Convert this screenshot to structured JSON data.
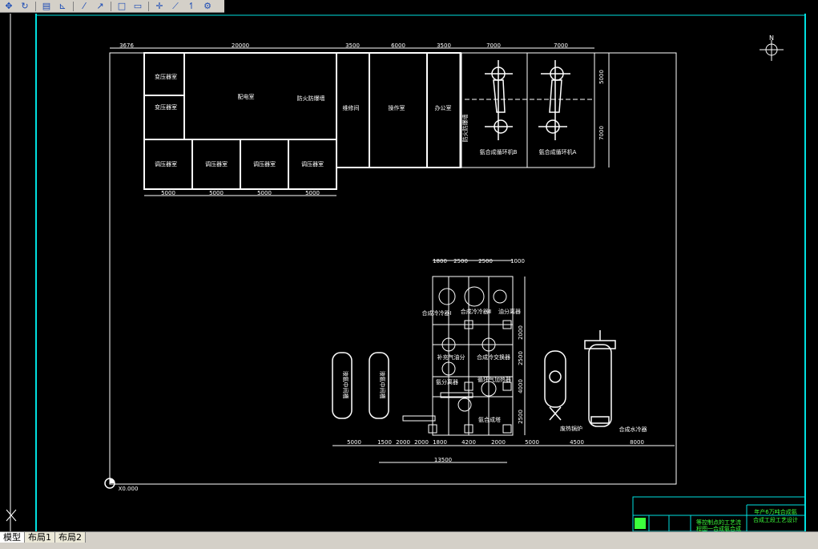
{
  "toolbar": {
    "buttons": [
      {
        "icon": "pan-icon",
        "glyph": "✥"
      },
      {
        "icon": "orbit-icon",
        "glyph": "↻"
      },
      {
        "icon": "sheet-icon",
        "glyph": "▤"
      },
      {
        "icon": "measure-icon",
        "glyph": "⊾"
      },
      {
        "icon": "line-icon",
        "glyph": "⁄"
      },
      {
        "icon": "polyline-icon",
        "glyph": "↗"
      },
      {
        "icon": "rectangle-icon",
        "glyph": "□"
      },
      {
        "icon": "box-icon",
        "glyph": "▭"
      },
      {
        "icon": "move-icon",
        "glyph": "✛"
      },
      {
        "icon": "arc-icon",
        "glyph": "⟋"
      },
      {
        "icon": "pin-icon",
        "glyph": "↿"
      },
      {
        "icon": "properties-icon",
        "glyph": "⚙"
      }
    ]
  },
  "colors": {
    "background": "#000000",
    "lines": "#ffffff",
    "border": "#00e0e0",
    "titleblock_text": "#3cff3c"
  },
  "plan_top": {
    "dims": {
      "d1": "3676",
      "d2": "20000",
      "d3": "3500",
      "d4": "6000",
      "d5": "3500",
      "d6": "7000",
      "d7": "7000",
      "b1": "5000",
      "b2": "5000",
      "b3": "5000",
      "b4": "5000",
      "r1": "5000",
      "r2": "7000"
    },
    "rooms": {
      "transformer1": "变压器室",
      "transformer2": "变压器室",
      "distribution": "配电室",
      "firewall1": "防火防爆墙",
      "repair": "维修间",
      "operation": "操作室",
      "office": "办公室",
      "firewall2": "防火防爆墙",
      "regulator1": "调压器室",
      "regulator2": "调压器室",
      "regulator3": "调压器室",
      "regulator4": "调压器室",
      "compressor_b": "氨合成循环机B",
      "compressor_a": "氨合成循环机A"
    }
  },
  "plan_bottom": {
    "top_dims": {
      "t1": "1800",
      "t2": "2500",
      "t3": "2500",
      "t4": "1000"
    },
    "side_dims": {
      "s1": "2000",
      "s2": "2500",
      "s3": "4000",
      "s4": "2500"
    },
    "bottom_dims": {
      "b1": "5000",
      "b2": "1500",
      "b3": "2000",
      "b4": "2000",
      "b5": "1800",
      "b6": "4200",
      "b7": "2000",
      "b8": "5000",
      "b9": "4500",
      "b10": "8000",
      "total": "13500"
    },
    "equipment": {
      "cooler1": "合成冷冷器Ⅰ",
      "cooler2": "合成冷冷器Ⅱ",
      "separator": "油分离器",
      "supplement": "补充气油分",
      "heat_exchanger": "合成冷交换器",
      "ammonia_sep": "氨分离器",
      "circ_heater": "循环气加热器",
      "synthesis_tower": "氨合成塔",
      "waste_boiler": "废热锅炉",
      "water_cooler": "合成水冷器",
      "vessel1": "液氨中间槽",
      "vessel2": "液氨中间槽"
    }
  },
  "origin_label": "X0.000",
  "compass_label": "N",
  "titleblock": {
    "line1": "年产6万吨合成氨",
    "line2": "合成工段工艺设计",
    "line3": "等控制点的工艺流",
    "line4": "程图一合成氨合成"
  },
  "layout_tabs": [
    "模型",
    "布局1",
    "布局2"
  ]
}
